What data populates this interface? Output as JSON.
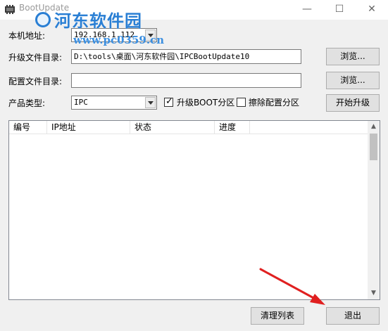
{
  "window": {
    "title": "BootUpdate",
    "minimize": "—",
    "maximize": "☐",
    "close": "✕"
  },
  "watermark": {
    "title": "河东软件园",
    "url": "www.pc0359.cn"
  },
  "form": {
    "local_address_label": "本机地址:",
    "local_address_value": "192.168.1.112",
    "upgrade_dir_label": "升级文件目录:",
    "upgrade_dir_value": "D:\\tools\\桌面\\河东软件园\\IPCBootUpdate10",
    "config_dir_label": "配置文件目录:",
    "config_dir_value": "",
    "product_type_label": "产品类型:",
    "product_type_value": "IPC",
    "upgrade_boot_label": "升级BOOT分区",
    "upgrade_boot_checked": true,
    "erase_config_label": "擦除配置分区",
    "erase_config_checked": false
  },
  "buttons": {
    "browse_upgrade": "浏览...",
    "browse_config": "浏览...",
    "start_upgrade": "开始升级",
    "clear_list": "清理列表",
    "exit": "退出"
  },
  "table": {
    "columns": [
      "编号",
      "IP地址",
      "状态",
      "进度"
    ],
    "rows": []
  },
  "colors": {
    "watermark_blue": "#2a7fd4",
    "annotation_arrow": "#e02020"
  }
}
